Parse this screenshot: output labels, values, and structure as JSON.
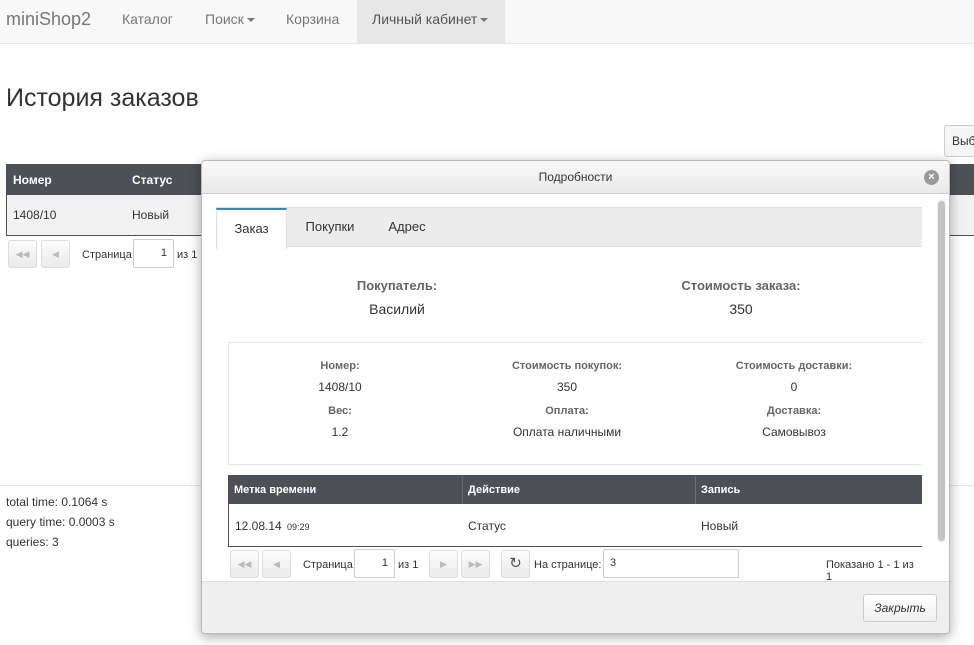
{
  "navbar": {
    "brand": "miniShop2",
    "items": [
      {
        "label": "Каталог"
      },
      {
        "label": "Поиск"
      },
      {
        "label": "Корзина"
      },
      {
        "label": "Личный кабинет"
      }
    ]
  },
  "page": {
    "title": "История заказов",
    "select_button_label": "Выб"
  },
  "orders_table": {
    "columns": [
      "Номер",
      "Статус"
    ],
    "rows": [
      {
        "number": "1408/10",
        "status": "Новый"
      }
    ]
  },
  "orders_pager": {
    "page_label": "Страница",
    "page_value": "1",
    "of_label": "из 1"
  },
  "stats": {
    "total_time": "total time: 0.1064 s",
    "query_time": "query time: 0.0003 s",
    "queries": "queries: 3"
  },
  "modal": {
    "title": "Подробности",
    "close_icon": "×",
    "tabs": [
      {
        "label": "Заказ",
        "active": true
      },
      {
        "label": "Покупки",
        "active": false
      },
      {
        "label": "Адрес",
        "active": false
      }
    ],
    "summary": {
      "customer_label": "Покупатель:",
      "customer_value": "Василий",
      "order_cost_label": "Стоимость заказа:",
      "order_cost_value": "350"
    },
    "details": {
      "number_label": "Номер:",
      "number_value": "1408/10",
      "goods_cost_label": "Стоимость покупок:",
      "goods_cost_value": "350",
      "delivery_cost_label": "Стоимость доставки:",
      "delivery_cost_value": "0",
      "weight_label": "Вес:",
      "weight_value": "1.2",
      "payment_label": "Оплата:",
      "payment_value": "Оплата наличными",
      "delivery_label": "Доставка:",
      "delivery_value": "Самовывоз"
    },
    "log_table": {
      "columns": [
        "Метка времени",
        "Действие",
        "Запись"
      ],
      "rows": [
        {
          "date": "12.08.14",
          "time": "09:29",
          "action": "Статус",
          "entry": "Новый"
        }
      ]
    },
    "log_pager": {
      "page_label": "Страница",
      "page_value": "1",
      "of_label": "из 1",
      "per_page_label": "На странице:",
      "per_page_value": "3",
      "shown": "Показано 1 - 1 из 1"
    },
    "close_button_label": "Закрыть"
  },
  "icons": {
    "first": "first-page-icon",
    "prev": "prev-page-icon",
    "next": "next-page-icon",
    "last": "last-page-icon",
    "refresh": "refresh-icon",
    "close": "close-icon",
    "caret": "caret-down-icon"
  },
  "colors": {
    "table_header": "#4d5157",
    "navbar_bg": "#f8f8f8",
    "active_tab_border": "#3a87ad"
  }
}
